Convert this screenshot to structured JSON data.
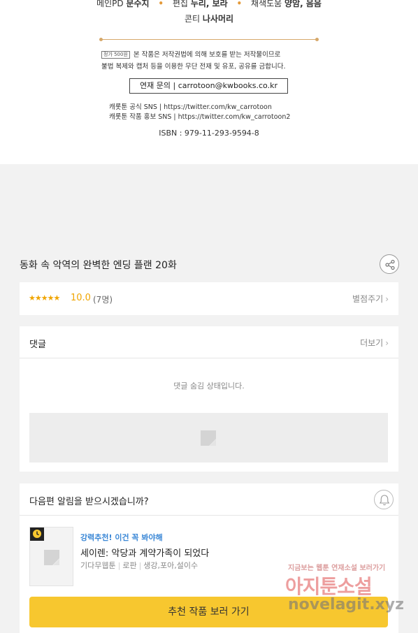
{
  "credits": {
    "role1_label": "메인PD",
    "role1_name": "문수지",
    "role2_label": "편집",
    "role2_name": "누리, 보라",
    "role3_label": "채색도움",
    "role3_name": "양암, 음음",
    "role4_label": "콘티",
    "role4_name": "나사머리",
    "price_tag": "정가 500원",
    "copyright_line1": "본 작품은 저작권법에 의해 보호를 받는 저작물이므로",
    "copyright_line2": "불법 복제와 캡처 등을 이용한 무단 전재 및 유포, 공유를 금합니다.",
    "contact": "연재 문의 | carrotoon@kwbooks.co.kr",
    "sns1": "캐롯툰 공식 SNS | https://twitter.com/kw_carrotoon",
    "sns2": "캐롯툰 작품 홍보 SNS | https://twitter.com/kw_carrotoon2",
    "isbn": "ISBN : 979-11-293-9594-8"
  },
  "episode": {
    "title": "동화 속 악역의 완벽한 엔딩 플랜 20화",
    "share_icon": "share-icon"
  },
  "rating": {
    "stars": "★★★★★",
    "score": "10.0",
    "count": "(7명)",
    "rate_label": "별점주기"
  },
  "comments": {
    "title": "댓글",
    "more_label": "더보기",
    "hidden_message": "댓글 숨김 상태입니다."
  },
  "notify": {
    "question": "다음편 알림을 받으시겠습니까?",
    "bell_icon": "bell-icon"
  },
  "recommendation": {
    "tag": "강력추천! 이건 꼭 봐야해",
    "title": "세이렌: 악당과 계약가족이 되었다",
    "meta": [
      "기다무웹툰",
      "로판",
      "생강,포아,설이수"
    ],
    "button_label": "추천 작품 보러 가기"
  },
  "watermark": {
    "top": "지금보는 웹툰 연재소설 보러가기",
    "main": "아지툰소설",
    "url": "novelagit.xyz"
  },
  "colors": {
    "accent_yellow": "#f7c72f",
    "star_orange": "#f0a500",
    "tag_blue": "#3a87d6"
  }
}
